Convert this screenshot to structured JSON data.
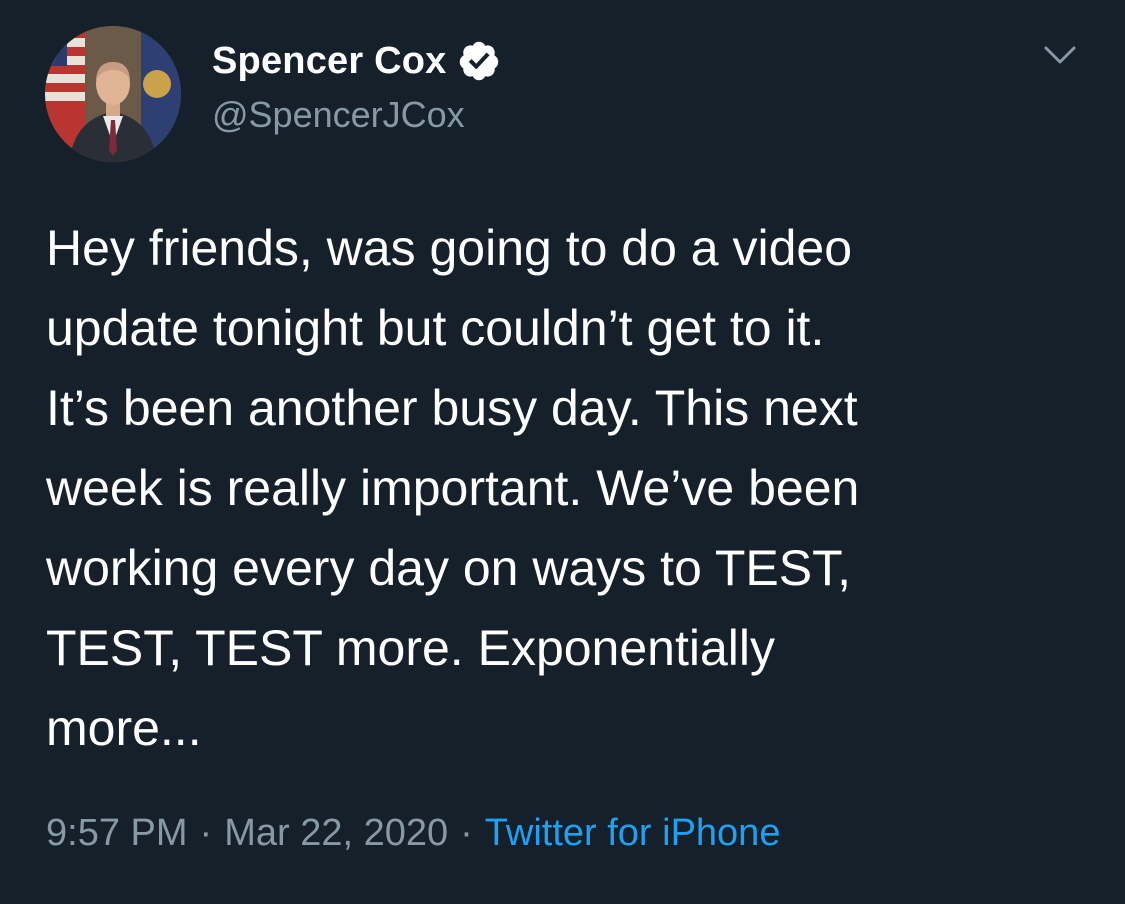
{
  "author": {
    "display_name": "Spencer Cox",
    "handle": "@SpencerJCox",
    "verified": true
  },
  "icons": {
    "avatar": "profile-photo",
    "verified": "verified-badge-icon",
    "menu": "chevron-down-icon"
  },
  "tweet": {
    "text": "Hey friends, was going to do a video\nupdate tonight but couldn’t get to it.\nIt’s been another busy day. This next\nweek is really important. We’ve been\nworking every day on ways to TEST,\nTEST, TEST more. Exponentially\nmore...",
    "time": "9:57 PM",
    "separator": "·",
    "date": "Mar 22, 2020",
    "source": "Twitter for iPhone"
  },
  "colors": {
    "background": "#15202b",
    "text": "#ffffff",
    "secondary": "#8899a6",
    "link": "#1da1f2"
  }
}
